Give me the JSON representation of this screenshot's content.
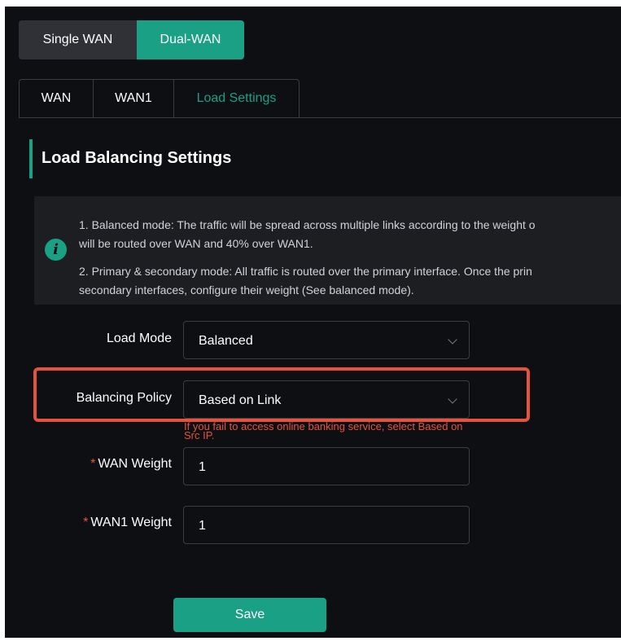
{
  "mode_switch": {
    "single_label": "Single WAN",
    "dual_label": "Dual-WAN",
    "selected": "Dual-WAN"
  },
  "tabs": [
    {
      "label": "WAN"
    },
    {
      "label": "WAN1"
    },
    {
      "label": "Load Settings",
      "active": true
    }
  ],
  "section": {
    "title": "Load Balancing Settings"
  },
  "info": {
    "icon": "info-icon",
    "line1a": "1. Balanced mode: The traffic will be spread across multiple links according to the weight o",
    "line1b": "will be routed over WAN and 40% over WAN1.",
    "line2a": "2. Primary & secondary mode: All traffic is routed over the primary interface. Once the prin",
    "line2b": "secondary interfaces, configure their weight (See balanced mode)."
  },
  "form": {
    "load_mode": {
      "label": "Load Mode",
      "value": "Balanced"
    },
    "balancing_policy": {
      "label": "Balancing Policy",
      "value": "Based on Link",
      "hint": "If you fail to access online banking service, select Based on Src IP."
    },
    "wan_weight": {
      "required_mark": "*",
      "label": "WAN Weight",
      "value": "1"
    },
    "wan1_weight": {
      "required_mark": "*",
      "label": "WAN1 Weight",
      "value": "1"
    }
  },
  "actions": {
    "save_label": "Save"
  },
  "colors": {
    "accent": "#1aa085",
    "background": "#0d0f12",
    "warning": "#e5533d"
  }
}
